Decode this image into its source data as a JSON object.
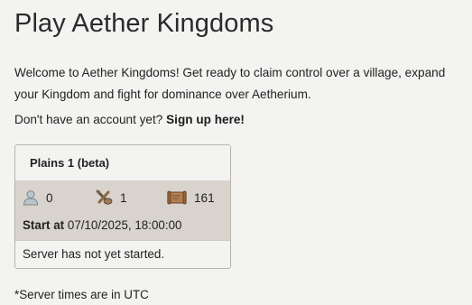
{
  "page": {
    "title": "Play Aether Kingdoms",
    "intro": "Welcome to Aether Kingdoms! Get ready to claim control over a village, expand your Kingdom and fight for dominance over Aetherium.",
    "signup_prompt": "Don't have an account yet?",
    "signup_link": "Sign up here!"
  },
  "server_card": {
    "name": "Plains 1 (beta)",
    "players_count": "0",
    "attacks_count": "1",
    "villages_count": "161",
    "start_label": "Start at",
    "start_value": "07/10/2025, 18:00:00",
    "status": "Server has not yet started.",
    "icons": {
      "players": "user-icon",
      "attacks": "crossed-weapons-icon",
      "villages": "scroll-map-icon"
    }
  },
  "footnote": "*Server times are in UTC",
  "colors": {
    "background": "#f3f3f1",
    "card_body": "#d8d3cd",
    "card_border": "#b7b3ab"
  }
}
